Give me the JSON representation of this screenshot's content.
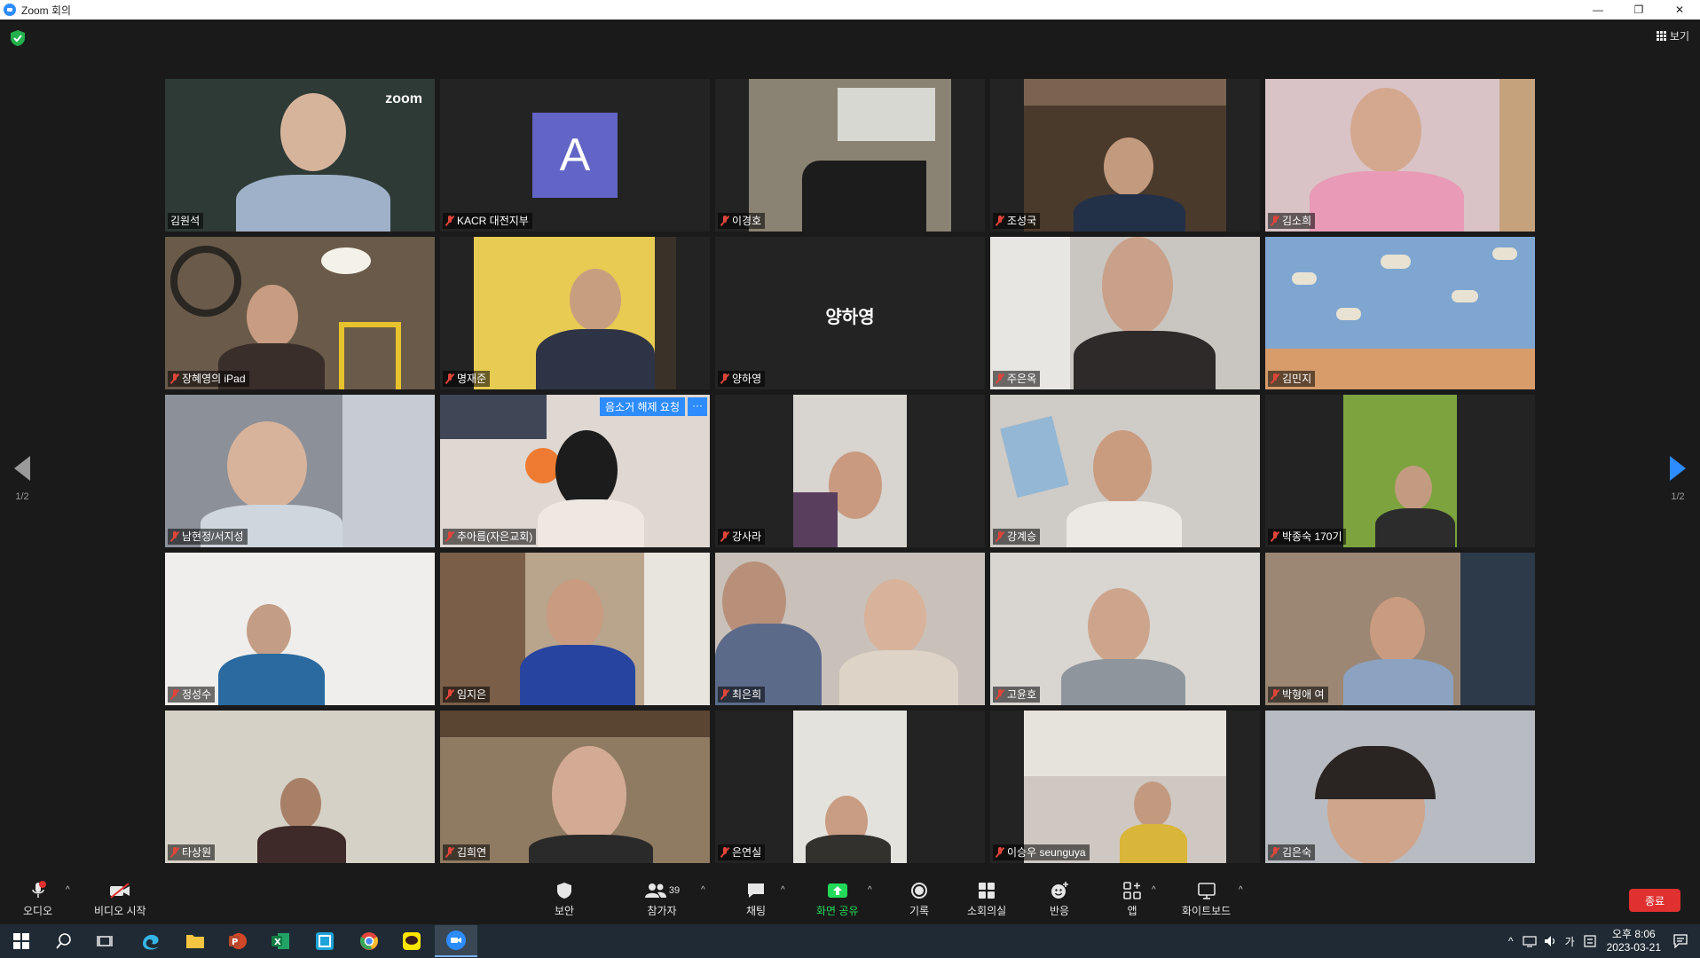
{
  "window": {
    "title": "Zoom 회의",
    "controls": [
      "—",
      "❐",
      "✕"
    ]
  },
  "meeting": {
    "view_label": "보기",
    "page_left": "1/2",
    "page_right": "1/2",
    "unmute_request": "음소거 해제 요청",
    "unmute_more": "···",
    "participants": [
      {
        "name": "김원석",
        "muted": false,
        "active": true
      },
      {
        "name": "KACR 대전지부",
        "muted": true,
        "avatar": "A"
      },
      {
        "name": "이경호",
        "muted": true
      },
      {
        "name": "조성국",
        "muted": true
      },
      {
        "name": "김소희",
        "muted": true
      },
      {
        "name": "장혜영의 iPad",
        "muted": true
      },
      {
        "name": "명재준",
        "muted": true
      },
      {
        "name": "양하영",
        "muted": true,
        "display_name": "양하영"
      },
      {
        "name": "주은옥",
        "muted": true
      },
      {
        "name": "김민지",
        "muted": true
      },
      {
        "name": "남현정/서지성",
        "muted": true
      },
      {
        "name": "추아름(자은교회)",
        "muted": true
      },
      {
        "name": "강사라",
        "muted": true
      },
      {
        "name": "강계승",
        "muted": true
      },
      {
        "name": "박종숙 170기",
        "muted": true
      },
      {
        "name": "정성수",
        "muted": true
      },
      {
        "name": "임지은",
        "muted": true
      },
      {
        "name": "최은희",
        "muted": true
      },
      {
        "name": "고윤호",
        "muted": true
      },
      {
        "name": "박형애 여",
        "muted": true
      },
      {
        "name": "타상원",
        "muted": true
      },
      {
        "name": "김희연",
        "muted": true
      },
      {
        "name": "은연실",
        "muted": true
      },
      {
        "name": "이승우 seunguya",
        "muted": true
      },
      {
        "name": "김은숙",
        "muted": true
      }
    ]
  },
  "toolbar": {
    "audio": "오디오",
    "video": "비디오 시작",
    "security": "보안",
    "participants": "참가자",
    "participants_count": "39",
    "chat": "채팅",
    "share": "화면 공유",
    "record": "기록",
    "breakout": "소회의실",
    "reactions": "반응",
    "apps": "앱",
    "whiteboard": "화이트보드",
    "end": "종료"
  },
  "taskbar": {
    "time": "오후 8:06",
    "date": "2023-03-21",
    "ime": "가"
  },
  "colors": {
    "accent_blue": "#2d8cff",
    "end_red": "#e0302f",
    "active_speaker": "#c9e33b",
    "share_green": "#23d959"
  }
}
